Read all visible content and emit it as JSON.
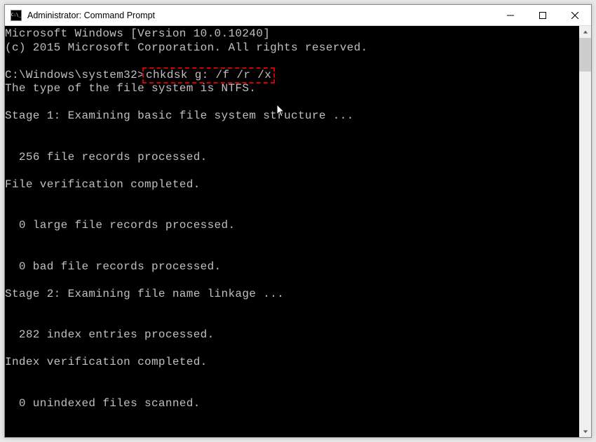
{
  "window": {
    "title": "Administrator: Command Prompt"
  },
  "terminal": {
    "line_01": "Microsoft Windows [Version 10.0.10240]",
    "line_02": "(c) 2015 Microsoft Corporation. All rights reserved.",
    "line_03_prompt": "C:\\Windows\\system32>",
    "line_03_cmd": "chkdsk g: /f /r /x",
    "line_04": "The type of the file system is NTFS.",
    "line_05": "Stage 1: Examining basic file system structure ...",
    "line_06": "  256 file records processed.",
    "line_07": "File verification completed.",
    "line_08": "  0 large file records processed.",
    "line_09": "  0 bad file records processed.",
    "line_10": "Stage 2: Examining file name linkage ...",
    "line_11": "  282 index entries processed.",
    "line_12": "Index verification completed.",
    "line_13": "  0 unindexed files scanned."
  }
}
